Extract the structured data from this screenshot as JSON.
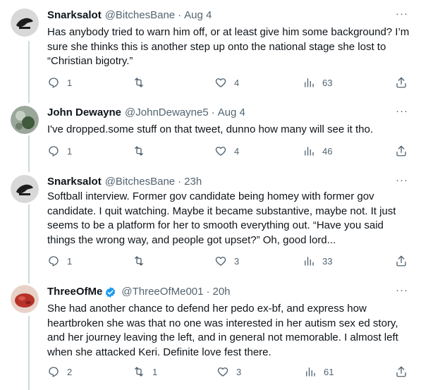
{
  "tweets": [
    {
      "name": "Snarksalot",
      "handle": "@BitchesBane",
      "time": "Aug 4",
      "verified": false,
      "more": "···",
      "text": "Has anybody tried to warn him off, or at least give him some background? I’m sure she thinks this is another step up onto the national stage she lost to “Christian bigotry.”",
      "replies": "1",
      "retweets": "",
      "likes": "4",
      "views": "63",
      "avatar_colors": [
        "#d8d8d8",
        "#1d1d1d"
      ]
    },
    {
      "name": "John Dewayne",
      "handle": "@JohnDewayne5",
      "time": "Aug 4",
      "verified": false,
      "more": "···",
      "text": "I've dropped.some stuff on that tweet, dunno how many will see it tho.",
      "replies": "1",
      "retweets": "",
      "likes": "4",
      "views": "46",
      "avatar_colors": [
        "#9aa79a",
        "#3f5a3c"
      ]
    },
    {
      "name": "Snarksalot",
      "handle": "@BitchesBane",
      "time": "23h",
      "verified": false,
      "more": "···",
      "text": "Softball interview. Former gov candidate being homey with former gov candidate. I quit watching. Maybe it became substantive, maybe not. It just seems to be a platform for her to smooth everything out. “Have you said things the wrong way, and people got upset?” Oh, good lord...",
      "replies": "1",
      "retweets": "",
      "likes": "3",
      "views": "33",
      "avatar_colors": [
        "#d8d8d8",
        "#1d1d1d"
      ]
    },
    {
      "name": "ThreeOfMe",
      "handle": "@ThreeOfMe001",
      "time": "20h",
      "verified": true,
      "more": "···",
      "text": "She had another chance to defend her pedo ex-bf, and express how heartbroken she was that no one was interested in her autism sex ed story, and her journey leaving the left, and in general not memorable. I almost left when she attacked Keri. Definite love fest there.",
      "replies": "2",
      "retweets": "1",
      "likes": "3",
      "views": "61",
      "avatar_colors": [
        "#e8d2c8",
        "#b8322a"
      ]
    }
  ],
  "colors": {
    "text": "#0f1419",
    "secondary": "#536471",
    "verified": "#1d9bf0",
    "thread_line": "#cfd9de"
  }
}
